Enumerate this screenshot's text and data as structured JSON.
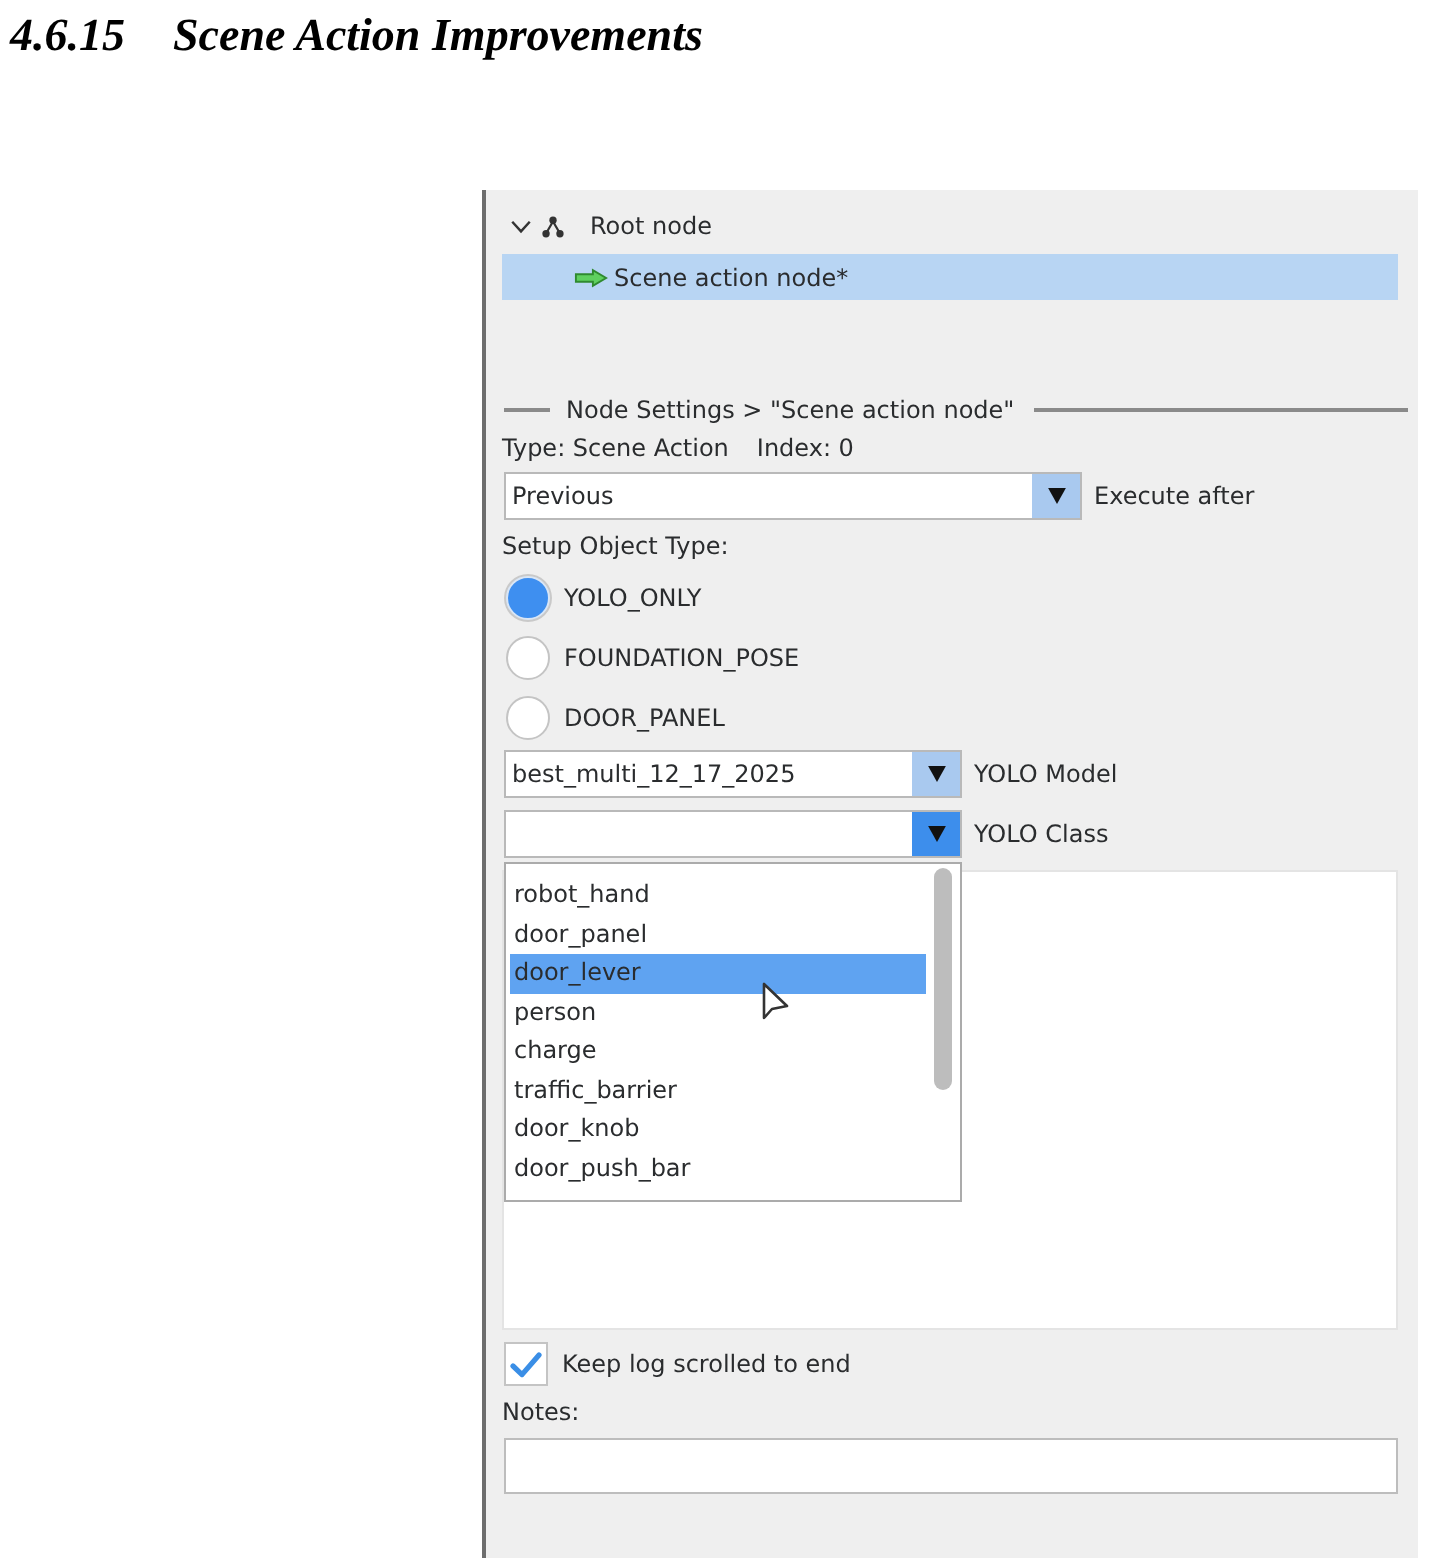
{
  "heading": {
    "number": "4.6.15",
    "title": "Scene Action Improvements"
  },
  "tree": {
    "root": {
      "label": "Root node",
      "expanded": true,
      "children": [
        {
          "label": "Scene action node*",
          "selected": true
        }
      ]
    }
  },
  "node_settings": {
    "title": "Node Settings > \"Scene action node\"",
    "type": "Type: Scene Action",
    "index": "Index: 0",
    "execute_after": {
      "value": "Previous",
      "label": "Execute after"
    },
    "object_type": {
      "label": "Setup Object Type:",
      "options": [
        {
          "label": "YOLO_ONLY",
          "selected": true
        },
        {
          "label": "FOUNDATION_POSE",
          "selected": false
        },
        {
          "label": "DOOR_PANEL",
          "selected": false
        }
      ]
    },
    "yolo_model": {
      "value": "best_multi_12_17_2025",
      "label": "YOLO Model"
    },
    "yolo_class": {
      "label": "YOLO Class",
      "expanded": true,
      "options": [
        {
          "label": "robot_hand",
          "selected": false
        },
        {
          "label": "door_panel",
          "selected": false
        },
        {
          "label": "door_lever",
          "selected": true
        },
        {
          "label": "person",
          "selected": false
        },
        {
          "label": "charge",
          "selected": false
        },
        {
          "label": "traffic_barrier",
          "selected": false
        },
        {
          "label": "door_knob",
          "selected": false
        },
        {
          "label": "door_push_bar",
          "selected": false
        }
      ]
    },
    "keep_log": {
      "label": "Keep log scrolled to end",
      "checked": true
    },
    "notes": {
      "label": "Notes:"
    }
  }
}
